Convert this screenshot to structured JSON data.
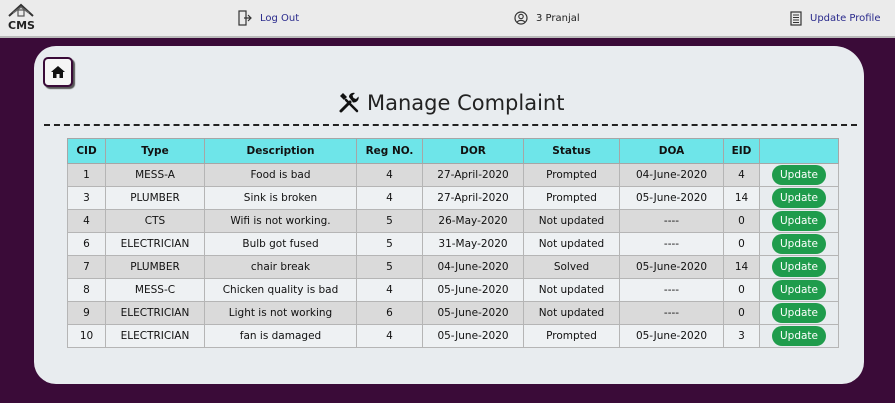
{
  "brand": {
    "logo_text": "CMS"
  },
  "nav": {
    "logout_label": "Log Out",
    "user_label": "3 Pranjal",
    "update_profile_label": "Update Profile"
  },
  "page": {
    "title": "Manage Complaint"
  },
  "table": {
    "headers": [
      "CID",
      "Type",
      "Description",
      "Reg NO.",
      "DOR",
      "Status",
      "DOA",
      "EID",
      ""
    ],
    "rows": [
      {
        "cid": "1",
        "type": "MESS-A",
        "description": "Food is bad",
        "reg": "4",
        "dor": "27-April-2020",
        "status": "Prompted",
        "doa": "04-June-2020",
        "eid": "4",
        "action": "Update"
      },
      {
        "cid": "3",
        "type": "PLUMBER",
        "description": "Sink is broken",
        "reg": "4",
        "dor": "27-April-2020",
        "status": "Prompted",
        "doa": "05-June-2020",
        "eid": "14",
        "action": "Update"
      },
      {
        "cid": "4",
        "type": "CTS",
        "description": "Wifi is not working.",
        "reg": "5",
        "dor": "26-May-2020",
        "status": "Not updated",
        "doa": "----",
        "eid": "0",
        "action": "Update"
      },
      {
        "cid": "6",
        "type": "ELECTRICIAN",
        "description": "Bulb got fused",
        "reg": "5",
        "dor": "31-May-2020",
        "status": "Not updated",
        "doa": "----",
        "eid": "0",
        "action": "Update"
      },
      {
        "cid": "7",
        "type": "PLUMBER",
        "description": "chair break",
        "reg": "5",
        "dor": "04-June-2020",
        "status": "Solved",
        "doa": "05-June-2020",
        "eid": "14",
        "action": "Update"
      },
      {
        "cid": "8",
        "type": "MESS-C",
        "description": "Chicken quality is bad",
        "reg": "4",
        "dor": "05-June-2020",
        "status": "Not updated",
        "doa": "----",
        "eid": "0",
        "action": "Update"
      },
      {
        "cid": "9",
        "type": "ELECTRICIAN",
        "description": "Light is not working",
        "reg": "6",
        "dor": "05-June-2020",
        "status": "Not updated",
        "doa": "----",
        "eid": "0",
        "action": "Update"
      },
      {
        "cid": "10",
        "type": "ELECTRICIAN",
        "description": "fan is damaged",
        "reg": "4",
        "dor": "05-June-2020",
        "status": "Prompted",
        "doa": "05-June-2020",
        "eid": "3",
        "action": "Update"
      }
    ]
  },
  "icons": {
    "logo": "house-roof-logo-icon",
    "logout": "logout-icon",
    "user": "user-circle-icon",
    "update_profile": "document-icon",
    "home": "home-icon",
    "title": "tools-icon"
  },
  "colors": {
    "page_bg": "#3a0b38",
    "header_cell": "#6ee5e9",
    "update_button": "#1f9c4c",
    "link": "#2a2a8c"
  }
}
